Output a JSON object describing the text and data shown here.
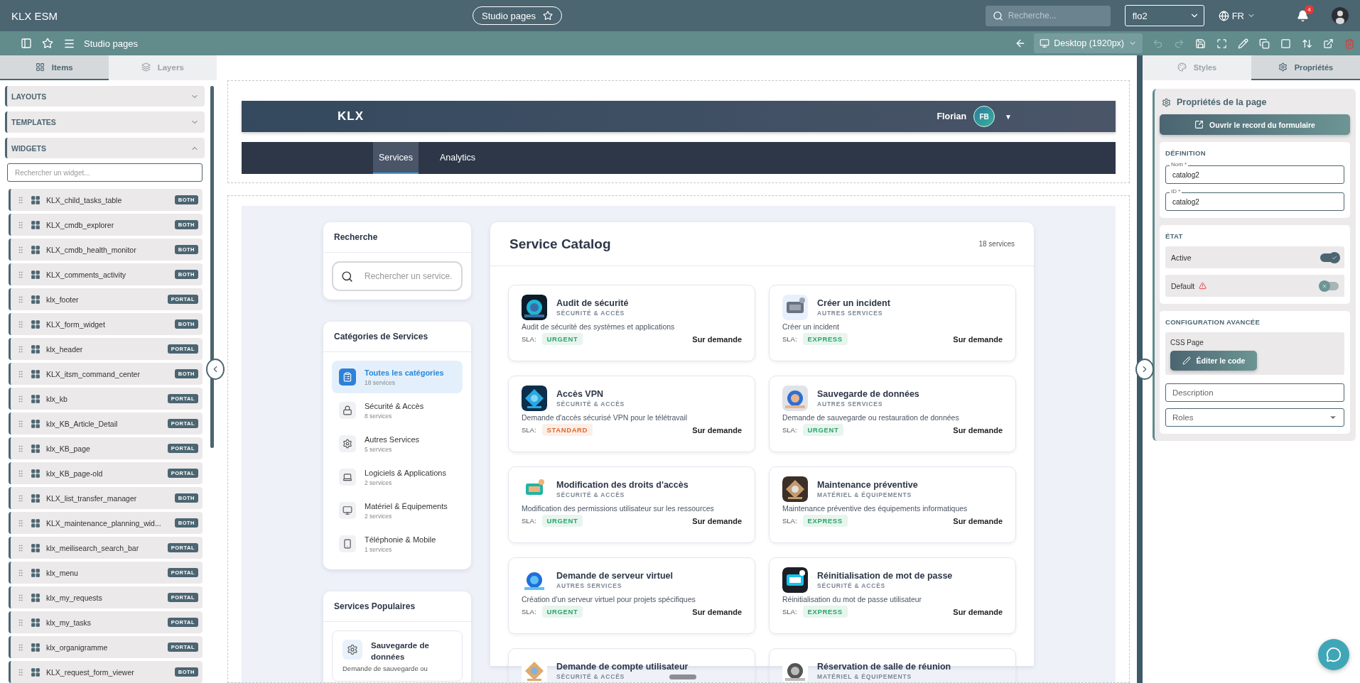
{
  "app": {
    "title": "KLX ESM",
    "page_button": "Studio pages",
    "search_placeholder": "Recherche...",
    "workspace": "flo2",
    "language": "FR",
    "notification_count": "4"
  },
  "toolbar": {
    "title": "Studio pages",
    "device": "Desktop (1920px)",
    "actions": [
      {
        "kind": "undo",
        "disabled": true
      },
      {
        "kind": "redo",
        "disabled": true
      },
      {
        "kind": "save",
        "disabled": false
      },
      {
        "kind": "fullscreen",
        "disabled": false
      },
      {
        "kind": "edit",
        "disabled": false
      },
      {
        "kind": "duplicate",
        "disabled": false
      },
      {
        "kind": "select",
        "disabled": false
      },
      {
        "kind": "sort",
        "disabled": false
      },
      {
        "kind": "open",
        "disabled": false
      },
      {
        "kind": "delete",
        "disabled": false
      }
    ]
  },
  "left_panel": {
    "tabs": [
      {
        "label": "Items",
        "selected": true
      },
      {
        "label": "Layers",
        "selected": false
      }
    ],
    "sections": [
      {
        "label": "LAYOUTS",
        "expanded": false
      },
      {
        "label": "TEMPLATES",
        "expanded": false
      },
      {
        "label": "WIDGETS",
        "expanded": true
      }
    ],
    "widget_search_placeholder": "Rechercher un widget...",
    "widgets": [
      {
        "name": "KLX_child_tasks_table",
        "badge": "BOTH"
      },
      {
        "name": "KLX_cmdb_explorer",
        "badge": "BOTH"
      },
      {
        "name": "KLX_cmdb_health_monitor",
        "badge": "BOTH"
      },
      {
        "name": "KLX_comments_activity",
        "badge": "BOTH"
      },
      {
        "name": "klx_footer",
        "badge": "PORTAL"
      },
      {
        "name": "KLX_form_widget",
        "badge": "BOTH"
      },
      {
        "name": "klx_header",
        "badge": "PORTAL"
      },
      {
        "name": "KLX_itsm_command_center",
        "badge": "BOTH"
      },
      {
        "name": "klx_kb",
        "badge": "PORTAL"
      },
      {
        "name": "klx_KB_Article_Detail",
        "badge": "PORTAL"
      },
      {
        "name": "klx_KB_page",
        "badge": "PORTAL"
      },
      {
        "name": "klx_KB_page-old",
        "badge": "PORTAL"
      },
      {
        "name": "KLX_list_transfer_manager",
        "badge": "BOTH"
      },
      {
        "name": "KLX_maintenance_planning_wid...",
        "badge": "BOTH"
      },
      {
        "name": "klx_meilisearch_search_bar",
        "badge": "PORTAL"
      },
      {
        "name": "klx_menu",
        "badge": "PORTAL"
      },
      {
        "name": "klx_my_requests",
        "badge": "PORTAL"
      },
      {
        "name": "klx_my_tasks",
        "badge": "PORTAL"
      },
      {
        "name": "klx_organigramme",
        "badge": "PORTAL"
      },
      {
        "name": "KLX_request_form_viewer",
        "badge": "BOTH"
      }
    ]
  },
  "canvas": {
    "site_header": {
      "brand": "KLX",
      "user": "Florian",
      "initials": "FB",
      "caret": "▼"
    },
    "nav": [
      {
        "label": "Services",
        "selected": true
      },
      {
        "label": "Analytics",
        "selected": false
      }
    ],
    "search": {
      "title": "Recherche",
      "placeholder": "Rechercher un service."
    },
    "categories": {
      "title": "Catégories de Services",
      "items": [
        {
          "name": "Toutes les catégories",
          "count": "18 services",
          "selected": true
        },
        {
          "name": "Sécurité & Accès",
          "count": "8 services",
          "selected": false
        },
        {
          "name": "Autres Services",
          "count": "5 services",
          "selected": false
        },
        {
          "name": "Logiciels & Applications",
          "count": "2 services",
          "selected": false
        },
        {
          "name": "Matériel & Équipements",
          "count": "2 services",
          "selected": false
        },
        {
          "name": "Téléphonie & Mobile",
          "count": "1 services",
          "selected": false
        }
      ]
    },
    "popular": {
      "title": "Services Populaires",
      "items": [
        {
          "name": "Sauvegarde de données",
          "description": "Demande de sauvegarde ou"
        }
      ]
    },
    "catalog": {
      "title": "Service Catalog",
      "count": "18 services",
      "services": [
        {
          "name": "Audit de sécurité",
          "category": "SÉCURITÉ & ACCÈS",
          "description": "Audit de sécurité des systèmes et applications",
          "sla_label": "SLA:",
          "sla": {
            "label": "URGENT",
            "color": "#27a567"
          },
          "availability": "Sur demande"
        },
        {
          "name": "Créer un incident",
          "category": "AUTRES SERVICES",
          "description": "Créer un incident",
          "sla_label": "SLA:",
          "sla": {
            "label": "EXPRESS",
            "color": "#27a567"
          },
          "availability": "Sur demande"
        },
        {
          "name": "Accès VPN",
          "category": "SÉCURITÉ & ACCÈS",
          "description": "Demande d'accès sécurisé VPN pour le télétravail",
          "sla_label": "SLA:",
          "sla": {
            "label": "STANDARD",
            "color": "#e0692a"
          },
          "availability": "Sur demande"
        },
        {
          "name": "Sauvegarde de données",
          "category": "AUTRES SERVICES",
          "description": "Demande de sauvegarde ou restauration de données",
          "sla_label": "SLA:",
          "sla": {
            "label": "URGENT",
            "color": "#27a567"
          },
          "availability": "Sur demande"
        },
        {
          "name": "Modification des droits d'accès",
          "category": "SÉCURITÉ & ACCÈS",
          "description": "Modification des permissions utilisateur sur les ressources",
          "sla_label": "SLA:",
          "sla": {
            "label": "URGENT",
            "color": "#27a567"
          },
          "availability": "Sur demande"
        },
        {
          "name": "Maintenance préventive",
          "category": "MATÉRIEL & ÉQUIPEMENTS",
          "description": "Maintenance préventive des équipements informatiques",
          "sla_label": "SLA:",
          "sla": {
            "label": "EXPRESS",
            "color": "#27a567"
          },
          "availability": "Sur demande"
        },
        {
          "name": "Demande de serveur virtuel",
          "category": "AUTRES SERVICES",
          "description": "Création d'un serveur virtuel pour projets spécifiques",
          "sla_label": "SLA:",
          "sla": {
            "label": "URGENT",
            "color": "#27a567"
          },
          "availability": "Sur demande"
        },
        {
          "name": "Réinitialisation de mot de passe",
          "category": "SÉCURITÉ & ACCÈS",
          "description": "Réinitialisation du mot de passe utilisateur",
          "sla_label": "SLA:",
          "sla": {
            "label": "EXPRESS",
            "color": "#27a567"
          },
          "availability": "Sur demande"
        },
        {
          "name": "Demande de compte utilisateur",
          "category": "SÉCURITÉ & ACCÈS"
        },
        {
          "name": "Réservation de salle de réunion",
          "category": "MATÉRIEL & ÉQUIPEMENTS"
        }
      ]
    }
  },
  "right_panel": {
    "tabs": [
      {
        "label": "Styles",
        "selected": false
      },
      {
        "label": "Propriétés",
        "selected": true
      }
    ],
    "title": "Propriétés de la page",
    "open_button": "Ouvrir le record du formulaire",
    "definition": {
      "title": "DÉFINITION",
      "fields": [
        {
          "label": "Nom *",
          "value": "catalog2"
        },
        {
          "label": "ID *",
          "value": "catalog2"
        }
      ]
    },
    "state": {
      "title": "ÉTAT",
      "toggles": [
        {
          "label": "Active",
          "on": true,
          "warning": false
        },
        {
          "label": "Default",
          "on": false,
          "warning": true
        }
      ]
    },
    "advanced": {
      "title": "CONFIGURATION AVANCÉE",
      "css_label": "CSS Page",
      "edit_button": "Éditer le code",
      "description_placeholder": "Description",
      "roles_placeholder": "Roles"
    }
  }
}
